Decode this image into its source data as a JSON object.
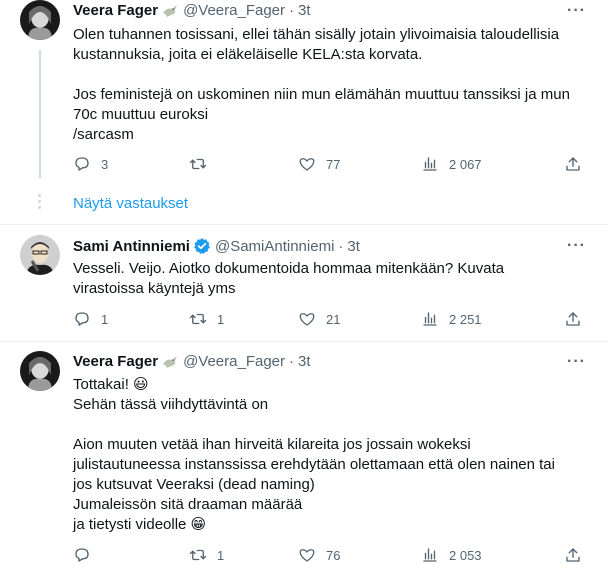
{
  "tweets": [
    {
      "name": "Veera Fager",
      "handle": "@Veera_Fager",
      "time": "3t",
      "badge": "dove",
      "paragraphs": [
        "Olen tuhannen tosissani, ellei tähän sisälly jotain ylivoimaisia taloudellisia\nkustannuksia, joita ei eläkeläiselle KELA:sta korvata.",
        "Jos feministejä on uskominen niin mun elämähän muuttuu tanssiksi ja mun\n70c muuttuu euroksi\n/sarcasm"
      ],
      "replies": "3",
      "retweets": "",
      "likes": "77",
      "views": "2 067"
    },
    {
      "name": "Sami Antinniemi",
      "handle": "@SamiAntinniemi",
      "time": "3t",
      "badge": "verified",
      "paragraphs": [
        "Vesseli. Veijo. Aiotko dokumentoida hommaa mitenkään? Kuvata\nvirastoissa käyntejä yms"
      ],
      "replies": "1",
      "retweets": "1",
      "likes": "21",
      "views": "2 251"
    },
    {
      "name": "Veera Fager",
      "handle": "@Veera_Fager",
      "time": "3t",
      "badge": "dove",
      "paragraphs": [
        "Tottakai! 😃\nSehän tässä viihdyttävintä on",
        "Aion muuten vetää ihan hirveitä kilareita jos jossain wokeksi\njulistautuneessa instanssissa erehdytään olettamaan että olen nainen tai\njos kutsuvat Veeraksi (dead naming)\nJumaleissön sitä draaman määrää\nja tietysti videolle 😁"
      ],
      "replies": "",
      "retweets": "1",
      "likes": "76",
      "views": "2 053"
    }
  ],
  "show_replies": "Näytä vastaukset",
  "more_icon": "more-dots-icon",
  "colors": {
    "link": "#1d9bf0",
    "muted": "#536471",
    "verified": "#1d9bf0",
    "text": "#0f1419"
  }
}
